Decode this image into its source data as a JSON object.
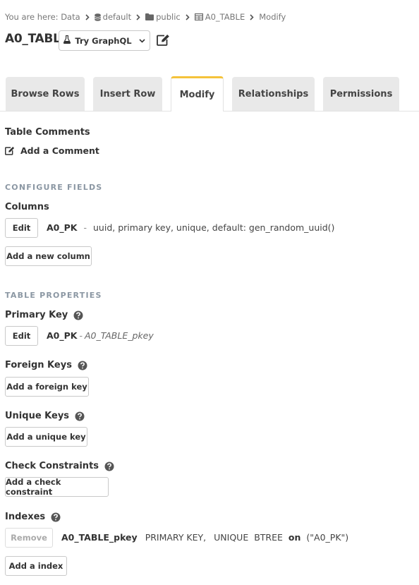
{
  "breadcrumb": {
    "prefix": "You are here:",
    "items": [
      "Data",
      "default",
      "public",
      "A0_TABLE",
      "Modify"
    ]
  },
  "title": "A0_TABLE",
  "graphql_button": "Try GraphQL",
  "tabs": [
    "Browse Rows",
    "Insert Row",
    "Modify",
    "Relationships",
    "Permissions"
  ],
  "active_tab": "Modify",
  "table_comments": {
    "heading": "Table Comments",
    "add_label": "Add a Comment"
  },
  "configure_fields": {
    "title": "CONFIGURE FIELDS",
    "columns_heading": "Columns",
    "edit_label": "Edit",
    "column_name": "A0_PK",
    "column_sep": "-",
    "column_desc": "uuid, primary key, unique, default: gen_random_uuid()",
    "add_column_label": "Add a new column"
  },
  "table_properties": {
    "title": "TABLE PROPERTIES",
    "primary_key": {
      "heading": "Primary Key",
      "edit_label": "Edit",
      "name": "A0_PK",
      "sep": "-",
      "constraint": "A0_TABLE_pkey"
    },
    "foreign_keys": {
      "heading": "Foreign Keys",
      "add_label": "Add a foreign key"
    },
    "unique_keys": {
      "heading": "Unique Keys",
      "add_label": "Add a unique key"
    },
    "check_constraints": {
      "heading": "Check Constraints",
      "add_label": "Add a check constraint"
    },
    "indexes": {
      "heading": "Indexes",
      "remove_label": "Remove",
      "index_name": "A0_TABLE_pkey",
      "type_primary": "PRIMARY KEY,",
      "type_unique": "UNIQUE",
      "method": "BTREE",
      "on_label": "on",
      "columns": "(\"A0_PK\")",
      "add_label": "Add a index"
    }
  },
  "colors": {
    "accent": "#f5c33b",
    "section_title": "#8b97a3",
    "tab_bg": "#e9e9e9"
  }
}
